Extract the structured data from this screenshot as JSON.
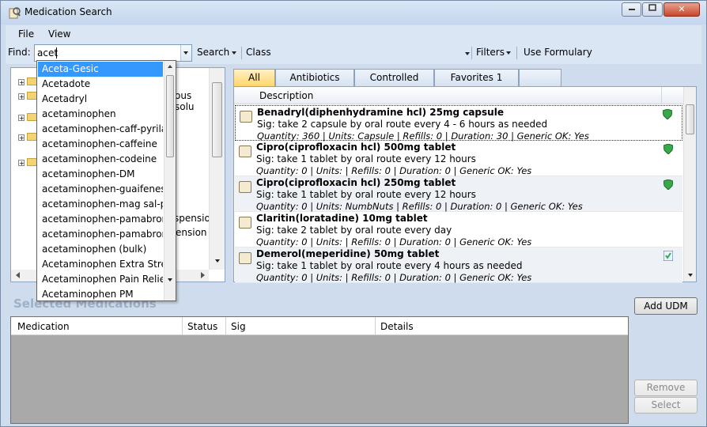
{
  "window": {
    "title": "Medication Search"
  },
  "menu": [
    "File",
    "View"
  ],
  "toolbar": {
    "find_label": "Find:",
    "find_value": "acet",
    "search_label": "Search",
    "class_label": "Class:",
    "class_value": "",
    "filters_label": "Filters",
    "use_formulary_label": "Use Formulary"
  },
  "tree_fragments": [
    "ous solu",
    "spension",
    "ension"
  ],
  "autocomplete": [
    "Aceta-Gesic",
    "Acetadote",
    "Acetadryl",
    "acetaminophen",
    "acetaminophen-caff-pyrilam",
    "acetaminophen-caffeine",
    "acetaminophen-codeine",
    "acetaminophen-DM",
    "acetaminophen-guaifenesin",
    "acetaminophen-mag sal-pan",
    "acetaminophen-pamabrom",
    "acetaminophen-pamabrom-",
    "acetaminophen (bulk)",
    "Acetaminophen Extra Strengt",
    "Acetaminophen Pain Relief",
    "Acetaminophen PM"
  ],
  "tabs": [
    "All",
    "Antibiotics",
    "Controlled",
    "Favorites 1",
    ""
  ],
  "grid": {
    "header": "Description",
    "rows": [
      {
        "name": "Benadryl(diphenhydramine hcl) 25mg capsule",
        "sig": "Sig: take 2 capsule by oral route  every 4 - 6 hours as needed",
        "details": "Quantity: 360 | Units: Capsule | Refills: 0 | Duration: 30 | Generic OK: Yes"
      },
      {
        "name": "Cipro(ciprofloxacin hcl) 500mg tablet",
        "sig": "Sig: take 1 tablet by oral route  every 12 hours",
        "details": "Quantity: 0 | Units:  | Refills: 0 | Duration: 0 | Generic OK: Yes"
      },
      {
        "name": "Cipro(ciprofloxacin hcl) 250mg tablet",
        "sig": "Sig: take 1 tablet by oral route  every 12 hours",
        "details": "Quantity: 0 | Units: NumbNuts | Refills: 0 | Duration: 0 | Generic OK: Yes"
      },
      {
        "name": "Claritin(loratadine) 10mg tablet",
        "sig": "Sig: take 2 tablet by oral route  every day",
        "details": "Quantity: 0 | Units:  | Refills: 0 | Duration: 0 | Generic OK: Yes"
      },
      {
        "name": "Demerol(meperidine) 50mg tablet",
        "sig": "Sig: take 1 tablet by oral route  every 4 hours as needed",
        "details": "Quantity: 0 | Units:  | Refills: 0 | Duration: 0 | Generic OK: Yes"
      }
    ]
  },
  "selected": {
    "title": "Selected Medications",
    "columns": [
      "Medication",
      "Status",
      "Sig",
      "Details"
    ]
  },
  "buttons": {
    "add_udm": "Add UDM",
    "remove": "Remove",
    "select": "Select"
  },
  "colors": {
    "highlight": "#3399ff",
    "tab_active": "#ffd66a",
    "frame": "#cfdced"
  }
}
